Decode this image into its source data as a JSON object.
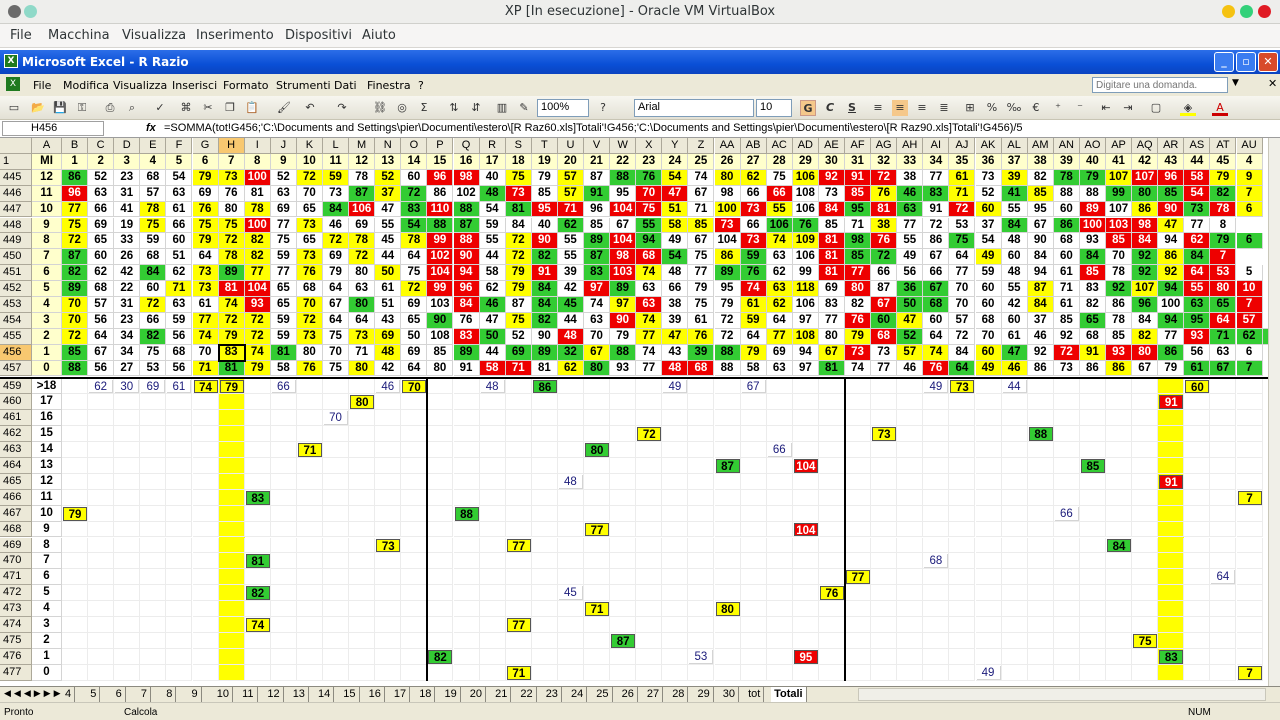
{
  "host": {
    "title": "XP [In esecuzione] - Oracle VM VirtualBox",
    "menu": [
      "File",
      "Macchina",
      "Visualizza",
      "Inserimento",
      "Dispositivi",
      "Aiuto"
    ]
  },
  "excel": {
    "title": "Microsoft Excel - R Razio",
    "menu": [
      "File",
      "Modifica",
      "Visualizza",
      "Inserisci",
      "Formato",
      "Strumenti",
      "Dati",
      "Finestra",
      "?"
    ],
    "help_placeholder": "Digitare una domanda.",
    "zoom": "100%",
    "font": "Arial",
    "font_size": "10",
    "name_box": "H456",
    "fx": "fx",
    "formula": "=SOMMA(tot!G456;'C:\\Documents and Settings\\pier\\Documenti\\estero\\[R Raz60.xls]Totali'!G456;'C:\\Documents and Settings\\pier\\Documenti\\estero\\[R Raz90.xls]Totali'!G456)/5",
    "status_left": "Pronto",
    "status_mid": "Calcola",
    "status_right": "NUM",
    "sheet_tabs": [
      "4",
      "5",
      "6",
      "7",
      "8",
      "9",
      "10",
      "11",
      "12",
      "13",
      "14",
      "15",
      "16",
      "17",
      "18",
      "19",
      "20",
      "21",
      "22",
      "23",
      "24",
      "25",
      "26",
      "27",
      "28",
      "29",
      "30",
      "tot",
      "Totali"
    ],
    "active_tab": "Totali"
  },
  "colors": {
    "green": "#33cc33",
    "yellow": "#ffff00",
    "red": "#ee0000",
    "header": "#ece9d8"
  },
  "grid": {
    "cols": [
      "A",
      "B",
      "C",
      "D",
      "E",
      "F",
      "G",
      "H",
      "I",
      "J",
      "K",
      "L",
      "M",
      "N",
      "O",
      "P",
      "Q",
      "R",
      "S",
      "T",
      "U",
      "V",
      "W",
      "X",
      "Y",
      "Z",
      "AA",
      "AB",
      "AC",
      "AD",
      "AE",
      "AF",
      "AG",
      "AH",
      "AI",
      "AJ",
      "AK",
      "AL",
      "AM",
      "AN",
      "AO",
      "AP",
      "AQ",
      "AR",
      "AS",
      "AT",
      "AU"
    ],
    "row1_label": "MI",
    "row1_values": [
      "1",
      "2",
      "3",
      "4",
      "5",
      "6",
      "7",
      "8",
      "9",
      "10",
      "11",
      "12",
      "13",
      "14",
      "15",
      "16",
      "17",
      "18",
      "19",
      "20",
      "21",
      "22",
      "23",
      "24",
      "25",
      "26",
      "27",
      "28",
      "29",
      "30",
      "31",
      "32",
      "33",
      "34",
      "35",
      "36",
      "37",
      "38",
      "39",
      "40",
      "41",
      "42",
      "43",
      "44",
      "45",
      "4"
    ],
    "top_rows": [
      {
        "r": "445",
        "a": "12",
        "v": "86 52 23 68 54 79 73 100 52 72 59 78 52 60 96 98 40 75 79 57 87 88 76 54 74 80 62 75 106 92 91 72 38 77 61 73 39 82 78 79 107 107 96 58 79 9",
        "c": "g....yyr.yy.y.rr.y.y.ggy.yy.yrrr..y.y.ggyrrryyr"
      },
      {
        "r": "446",
        "a": "11",
        "v": "96 63 31 57 63 69 76 81 63 70 73 87 37 72 86 102 48 73 85 57 91 95 70 47 67 98 66 66 108 73 85 76 46 83 71 52 41 85 88 88 99 80 85 54 82 7",
        "c": "r..........gyg..gr.yg.rr...r..ryggy.gy..gggrgygg"
      },
      {
        "r": "447",
        "a": "10",
        "v": "77 66 41 78 61 76 80 78 69 65 84 106 47 83 110 88 54 81 95 71 96 104 75 51 71 100 73 55 106 84 95 81 63 91 72 60 55 95 60 89 107 86 90 73 78 6",
        "c": "y..y.y.y..gr.grg.grr.rry.yry.rgrg.ry...r.yrgryy"
      },
      {
        "r": "448",
        "a": "9",
        "v": "75 69 19 75 66 75 75 100 77 73 46 69 55 54 88 87 59 84 40 62 85 67 55 58 85 73 66 106 76 85 71 38 77 72 53 37 84 67 86 100 103 98 47 77 8",
        "c": "y..y.yyr.y...ggg...g..gyyr.gg..y....g.grrry.."
      },
      {
        "r": "449",
        "a": "8",
        "v": "72 65 33 59 60 79 72 82 75 65 72 78 45 78 99 88 55 72 90 55 89 104 94 49 67 104 73 74 109 81 98 76 55 86 75 54 48 90 68 93 85 84 94 62 79 6",
        "c": "y....yyy..yy.yrr.yr.grg...ryyrgr..g.....rr.rggryy"
      },
      {
        "r": "450",
        "a": "7",
        "v": "87 60 26 68 51 64 78 82 59 73 69 72 44 64 102 90 44 72 82 55 87 98 68 54 75 86 59 63 106 81 85 72 49 67 64 49 60 84 60 84 70 92 86 84 7",
        "c": "g.....yy.y.y..rr.yg.grrg.yg..rgg...y...g.gygrgg"
      },
      {
        "r": "451",
        "a": "6",
        "v": "82 62 42 84 62 73 89 77 77 76 79 80 50 75 104 94 58 79 91 39 83 103 74 48 77 89 76 62 99 81 77 66 56 66 77 59 48 94 61 85 78 92 92 64 53 5",
        "c": "g..g.ygy.y..y.rr.yr.gry..gg..rr........r.gyrr.."
      },
      {
        "r": "452",
        "a": "5",
        "v": "89 68 22 60 71 73 81 104 65 68 64 63 61 72 99 96 62 79 84 42 97 89 63 66 79 95 74 63 118 69 80 87 36 67 70 60 55 87 71 83 92 107 94 55 80 10",
        "c": "g...yyrr.....yrr.yg.rg....ryy.r.gg...y..gygrrrrr"
      },
      {
        "r": "453",
        "a": "4",
        "v": "70 57 31 72 63 61 74 93 65 70 67 80 51 69 103 84 46 87 84 45 74 97 63 38 75 79 61 62 106 83 82 67 50 68 70 60 42 84 61 82 86 96 100 63 65 7",
        "c": "y..y..yr.y.g...rg.gg.yr...yy...rgg...y...g.ggrr.."
      },
      {
        "r": "454",
        "a": "3",
        "v": "70 56 23 66 59 77 72 72 59 72 64 64 43 65 90 76 47 75 82 44 63 90 74 39 61 72 59 64 97 77 76 60 47 60 57 68 60 37 85 65 78 84 94 95 64 57 7",
        "c": "y....yyy.y....g..yg..ry...y...rgy......g..ggrr.."
      },
      {
        "r": "455",
        "a": "2",
        "v": "72 64 34 82 56 74 79 72 59 73 75 73 69 50 108 83 50 52 90 48 70 79 77 47 76 72 64 77 108 80 79 68 52 64 72 70 61 46 92 68 85 82 77 93 71 62 7",
        "c": "y..g.yyy.y.yy..rg..r..yyy..yy.yrg........y.rgggy.ry."
      },
      {
        "r": "456",
        "a": "1",
        "v": "85 67 34 75 68 70 83 74 81 80 70 71 48 69 85 89 44 69 89 32 67 88 74 43 39 88 79 69 94 67 73 73 57 74 84 60 47 92 72 91 93 80 86 56 63 6",
        "c": "g.....yyg...y..g.gggyg..ggy..yr.yy.yg.ryrrg......"
      },
      {
        "r": "457",
        "a": "0",
        "v": "88 56 27 53 56 71 81 79 58 76 75 80 42 64 80 91 58 71 81 62 80 93 77 48 68 88 58 63 97 81 74 77 46 76 64 49 46 86 73 86 86 67 79 61 67 7",
        "c": "g....ygy.y.y....rr.yg..rr...ng...rgyy...y..ggggg..y"
      }
    ],
    "bottom_rows": [
      {
        "r": "459",
        "a": ">18",
        "cells": [
          [
            "C",
            "62",
            ""
          ],
          [
            "D",
            "30",
            ""
          ],
          [
            "E",
            "69",
            ""
          ],
          [
            "F",
            "61",
            ""
          ],
          [
            "G",
            "74",
            "y"
          ],
          [
            "H",
            "79",
            "y"
          ],
          [
            "J",
            "66",
            ""
          ],
          [
            "N",
            "46",
            ""
          ],
          [
            "O",
            "70",
            "y"
          ],
          [
            "R",
            "48",
            ""
          ],
          [
            "T",
            "86",
            "g"
          ],
          [
            "Y",
            "49",
            ""
          ],
          [
            "AB",
            "67",
            ""
          ],
          [
            "AI",
            "49",
            ""
          ],
          [
            "AJ",
            "73",
            "y"
          ],
          [
            "AL",
            "44",
            ""
          ],
          [
            "AS",
            "60",
            "y"
          ]
        ]
      },
      {
        "r": "460",
        "a": "17",
        "cells": [
          [
            "M",
            "80",
            "y"
          ],
          [
            "AR",
            "91",
            "r"
          ]
        ]
      },
      {
        "r": "461",
        "a": "16",
        "cells": [
          [
            "L",
            "70",
            ""
          ]
        ]
      },
      {
        "r": "462",
        "a": "15",
        "cells": [
          [
            "X",
            "72",
            "y"
          ],
          [
            "AG",
            "73",
            "y"
          ],
          [
            "AM",
            "88",
            "g"
          ]
        ]
      },
      {
        "r": "463",
        "a": "14",
        "cells": [
          [
            "K",
            "71",
            "y"
          ],
          [
            "V",
            "80",
            "g"
          ],
          [
            "AC",
            "66",
            ""
          ]
        ]
      },
      {
        "r": "464",
        "a": "13",
        "cells": [
          [
            "AA",
            "87",
            "g"
          ],
          [
            "AD",
            "104",
            "r"
          ],
          [
            "AO",
            "85",
            "g"
          ]
        ]
      },
      {
        "r": "465",
        "a": "12",
        "cells": [
          [
            "U",
            "48",
            ""
          ],
          [
            "AR",
            "91",
            "r"
          ]
        ]
      },
      {
        "r": "466",
        "a": "11",
        "cells": [
          [
            "I",
            "83",
            "g"
          ],
          [
            "AU",
            "7",
            "y"
          ]
        ]
      },
      {
        "r": "467",
        "a": "10",
        "cells": [
          [
            "B",
            "79",
            "y"
          ],
          [
            "Q",
            "88",
            "g"
          ],
          [
            "AN",
            "66",
            ""
          ]
        ]
      },
      {
        "r": "468",
        "a": "9",
        "cells": [
          [
            "V",
            "77",
            "y"
          ],
          [
            "AD",
            "104",
            "r"
          ]
        ]
      },
      {
        "r": "469",
        "a": "8",
        "cells": [
          [
            "N",
            "73",
            "y"
          ],
          [
            "S",
            "77",
            "y"
          ],
          [
            "AP",
            "84",
            "g"
          ]
        ]
      },
      {
        "r": "470",
        "a": "7",
        "cells": [
          [
            "I",
            "81",
            "g"
          ],
          [
            "AI",
            "68",
            ""
          ]
        ]
      },
      {
        "r": "471",
        "a": "6",
        "cells": [
          [
            "AF",
            "77",
            "y"
          ],
          [
            "AT",
            "64",
            ""
          ]
        ]
      },
      {
        "r": "472",
        "a": "5",
        "cells": [
          [
            "I",
            "82",
            "g"
          ],
          [
            "U",
            "45",
            ""
          ],
          [
            "AE",
            "76",
            "y"
          ]
        ]
      },
      {
        "r": "473",
        "a": "4",
        "cells": [
          [
            "V",
            "71",
            "y"
          ],
          [
            "AA",
            "80",
            "y"
          ]
        ]
      },
      {
        "r": "474",
        "a": "3",
        "cells": [
          [
            "I",
            "74",
            "y"
          ],
          [
            "S",
            "77",
            "y"
          ]
        ]
      },
      {
        "r": "475",
        "a": "2",
        "cells": [
          [
            "W",
            "87",
            "g"
          ],
          [
            "AQ",
            "75",
            "y"
          ]
        ]
      },
      {
        "r": "476",
        "a": "1",
        "cells": [
          [
            "P",
            "82",
            "g"
          ],
          [
            "Z",
            "53",
            ""
          ],
          [
            "AD",
            "95",
            "r"
          ],
          [
            "AR",
            "83",
            "g"
          ]
        ]
      },
      {
        "r": "477",
        "a": "0",
        "cells": [
          [
            "S",
            "71",
            "y"
          ],
          [
            "AK",
            "49",
            ""
          ],
          [
            "AU",
            "7",
            "y"
          ]
        ]
      }
    ]
  }
}
